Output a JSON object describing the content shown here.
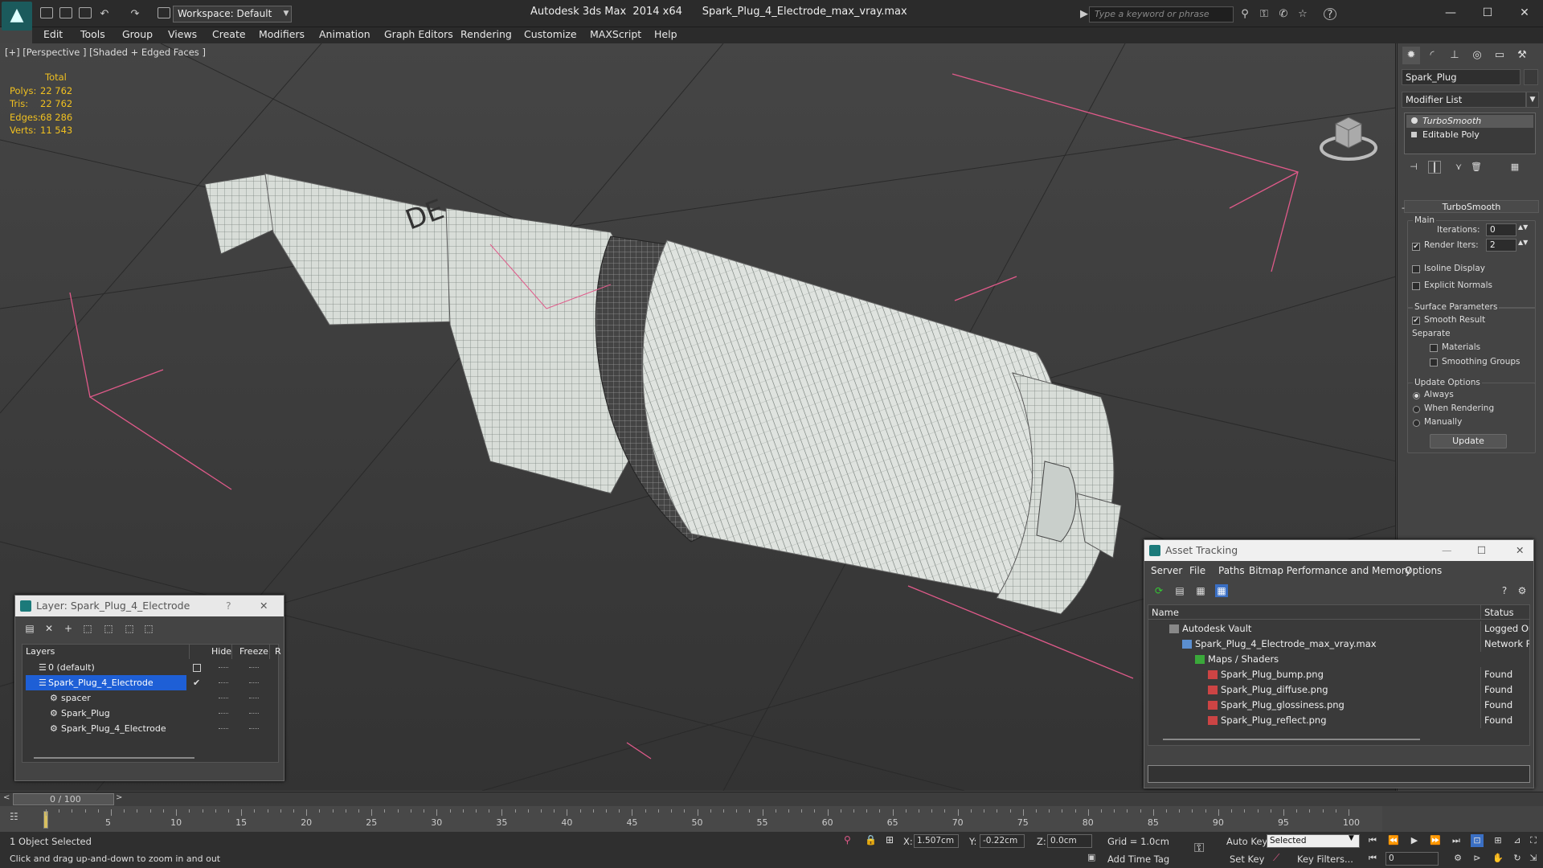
{
  "window": {
    "app_title": "Autodesk 3ds Max  2014 x64",
    "file_title": "Spark_Plug_4_Electrode_max_vray.max",
    "workspace": "Workspace: Default",
    "search_placeholder": "Type a keyword or phrase",
    "help_icon": "?"
  },
  "menu": [
    "Edit",
    "Tools",
    "Group",
    "Views",
    "Create",
    "Modifiers",
    "Animation",
    "Graph Editors",
    "Rendering",
    "Customize",
    "MAXScript",
    "Help"
  ],
  "viewport": {
    "label": "[+] [Perspective ] [Shaded + Edged Faces ]",
    "stats": {
      "header": "Total",
      "rows": [
        {
          "label": "Polys:",
          "value": "22 762"
        },
        {
          "label": "Tris:",
          "value": "22 762"
        },
        {
          "label": "Edges:",
          "value": "68 286"
        },
        {
          "label": "Verts:",
          "value": "11 543"
        }
      ]
    }
  },
  "command_panel": {
    "object_name": "Spark_Plug",
    "modifier_list": "Modifier List",
    "stack": [
      "TurboSmooth",
      "Editable Poly"
    ],
    "turbosmooth": {
      "title": "TurboSmooth",
      "main_label": "Main",
      "iterations_label": "Iterations:",
      "iterations_value": "0",
      "render_iters_label": "Render Iters:",
      "render_iters_value": "2",
      "isoline_label": "Isoline Display",
      "explicit_normals_label": "Explicit Normals",
      "surface_params_label": "Surface Parameters",
      "smooth_result_label": "Smooth Result",
      "separate_label": "Separate",
      "materials_label": "Materials",
      "smoothing_groups_label": "Smoothing Groups",
      "update_options_label": "Update Options",
      "always_label": "Always",
      "when_rendering_label": "When Rendering",
      "manually_label": "Manually",
      "update_button": "Update"
    }
  },
  "layer_dialog": {
    "title": "Layer: Spark_Plug_4_Electrode",
    "help": "?",
    "columns": {
      "layers": "Layers",
      "hide": "Hide",
      "freeze": "Freeze",
      "extra": "R"
    },
    "rows": [
      {
        "name": "0 (default)",
        "indent": 1
      },
      {
        "name": "Spark_Plug_4_Electrode",
        "indent": 1,
        "selected": true
      },
      {
        "name": "spacer",
        "indent": 2
      },
      {
        "name": "Spark_Plug",
        "indent": 2
      },
      {
        "name": "Spark_Plug_4_Electrode",
        "indent": 2
      }
    ]
  },
  "asset_tracking": {
    "title": "Asset Tracking",
    "menu": [
      "Server",
      "File",
      "Paths",
      "Bitmap Performance and Memory",
      "Options"
    ],
    "columns": {
      "name": "Name",
      "status": "Status"
    },
    "rows": [
      {
        "name": "Autodesk Vault",
        "status": "Logged Out",
        "indent": 1
      },
      {
        "name": "Spark_Plug_4_Electrode_max_vray.max",
        "status": "Network Pa",
        "indent": 2
      },
      {
        "name": "Maps / Shaders",
        "status": "",
        "indent": 3
      },
      {
        "name": "Spark_Plug_bump.png",
        "status": "Found",
        "indent": 4
      },
      {
        "name": "Spark_Plug_diffuse.png",
        "status": "Found",
        "indent": 4
      },
      {
        "name": "Spark_Plug_glossiness.png",
        "status": "Found",
        "indent": 4
      },
      {
        "name": "Spark_Plug_reflect.png",
        "status": "Found",
        "indent": 4
      }
    ]
  },
  "timeline": {
    "slider_text": "0 / 100",
    "ticks": [
      "5",
      "10",
      "15",
      "20",
      "25",
      "30",
      "35",
      "40",
      "45",
      "50",
      "55",
      "60",
      "65",
      "70",
      "75",
      "80",
      "85",
      "90",
      "95",
      "100"
    ]
  },
  "status": {
    "selection": "1 Object Selected",
    "prompt": "Click and drag up-and-down to zoom in and out",
    "x_label": "X:",
    "x_value": "1.507cm",
    "y_label": "Y:",
    "y_value": "-0.22cm",
    "z_label": "Z:",
    "z_value": "0.0cm",
    "grid": "Grid = 1.0cm",
    "add_time_tag": "Add Time Tag",
    "auto_key": "Auto Key",
    "set_key": "Set Key",
    "selected_dropdown": "Selected",
    "key_filters": "Key Filters...",
    "frame_value": "0"
  },
  "colors": {
    "accent": "#1b7a7a",
    "stat_yellow": "#f0c020",
    "selection_blue": "#1e5fd6",
    "bbox_pink": "#e05a8a"
  }
}
